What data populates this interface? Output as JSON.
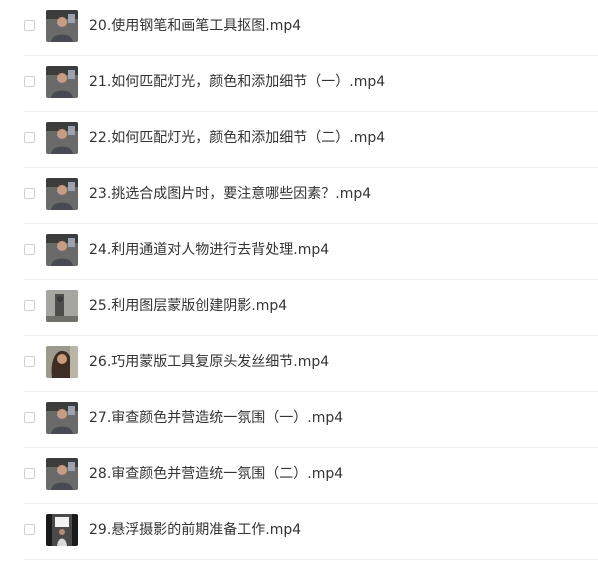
{
  "files": [
    {
      "name": "20.使用钢笔和画笔工具抠图.mp4",
      "thumb": "video-thumbnail-icon"
    },
    {
      "name": "21.如何匹配灯光，颜色和添加细节（一）.mp4",
      "thumb": "video-thumbnail-icon"
    },
    {
      "name": "22.如何匹配灯光，颜色和添加细节（二）.mp4",
      "thumb": "video-thumbnail-icon"
    },
    {
      "name": "23.挑选合成图片时，要注意哪些因素？.mp4",
      "thumb": "video-thumbnail-icon"
    },
    {
      "name": "24.利用通道对人物进行去背处理.mp4",
      "thumb": "video-thumbnail-icon"
    },
    {
      "name": "25.利用图层蒙版创建阴影.mp4",
      "thumb": "video-thumbnail-icon"
    },
    {
      "name": "26.巧用蒙版工具复原头发丝细节.mp4",
      "thumb": "video-thumbnail-icon"
    },
    {
      "name": "27.审查颜色并营造统一氛围（一）.mp4",
      "thumb": "video-thumbnail-icon"
    },
    {
      "name": "28.审查颜色并营造统一氛围（二）.mp4",
      "thumb": "video-thumbnail-icon"
    },
    {
      "name": "29.悬浮摄影的前期准备工作.mp4",
      "thumb": "video-thumbnail-icon"
    }
  ],
  "colors": {
    "text": "#333333",
    "divider": "#eeeeee",
    "checkbox_border": "#d0d0d0"
  }
}
